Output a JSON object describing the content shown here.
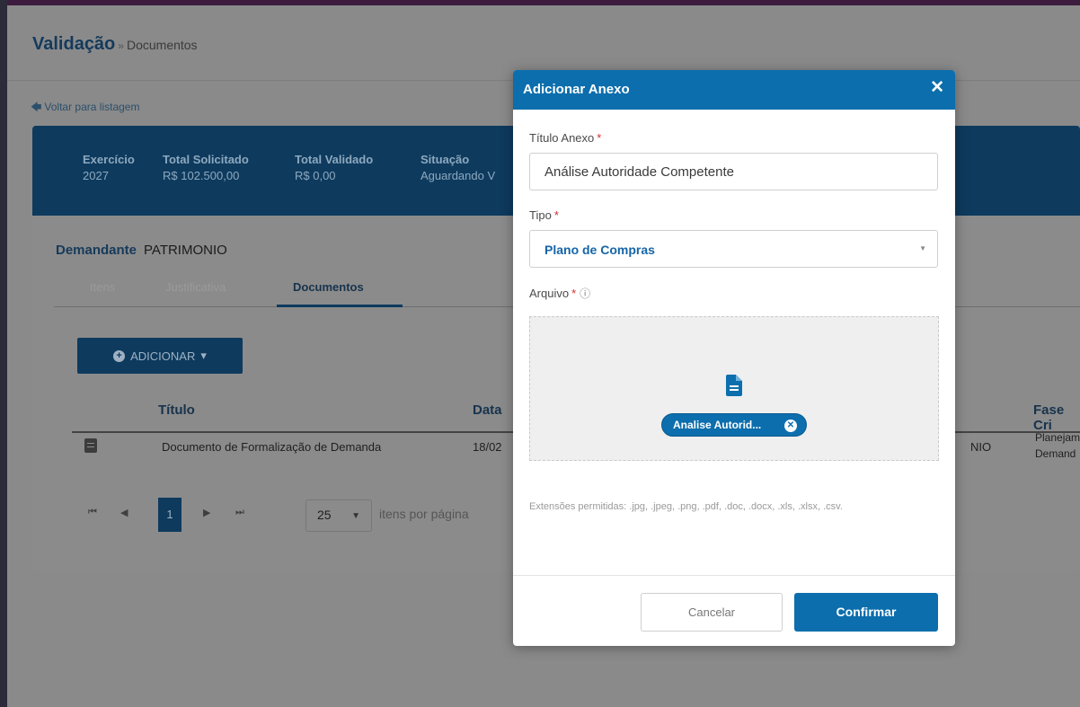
{
  "breadcrumb": {
    "title": "Validação",
    "separator": "»",
    "current": "Documentos"
  },
  "back_link": {
    "label": "Voltar para listagem"
  },
  "summary": [
    {
      "label": "Exercício",
      "value": "2027"
    },
    {
      "label": "Total Solicitado",
      "value": "R$ 102.500,00"
    },
    {
      "label": "Total Validado",
      "value": "R$ 0,00"
    },
    {
      "label": "Situação",
      "value": "Aguardando V"
    }
  ],
  "demandante": {
    "label": "Demandante",
    "value": "PATRIMONIO"
  },
  "tabs": [
    {
      "label": "Itens"
    },
    {
      "label": "Justificativa"
    },
    {
      "label": "Documentos",
      "active": true
    }
  ],
  "add_button": {
    "label": "ADICIONAR"
  },
  "table": {
    "headers": {
      "titulo": "Título",
      "data": "Data",
      "fase": "Fase Cri"
    },
    "rows": [
      {
        "titulo": "Documento de Formalização de Demanda",
        "data": "18/02",
        "demandante": "NIO",
        "fase_line1": "Planejam",
        "fase_line2": "Demand"
      }
    ]
  },
  "pager": {
    "current_page": "1",
    "page_size": "25",
    "page_size_label": "itens por página"
  },
  "modal": {
    "title": "Adicionar Anexo",
    "titulo_label": "Título Anexo",
    "titulo_value": "Análise Autoridade Competente",
    "tipo_label": "Tipo",
    "tipo_value": "Plano de Compras",
    "arquivo_label": "Arquivo",
    "file_chip": "Analise Autorid...",
    "extensions_note": "Extensões permitidas: .jpg, .jpeg, .png, .pdf, .doc, .docx, .xls, .xlsx, .csv.",
    "cancel_label": "Cancelar",
    "confirm_label": "Confirmar"
  },
  "colors": {
    "primary": "#0c6ead",
    "header_dark": "#0e3a5e",
    "required": "#d12e2e",
    "overlay": "#8a8a8a"
  }
}
